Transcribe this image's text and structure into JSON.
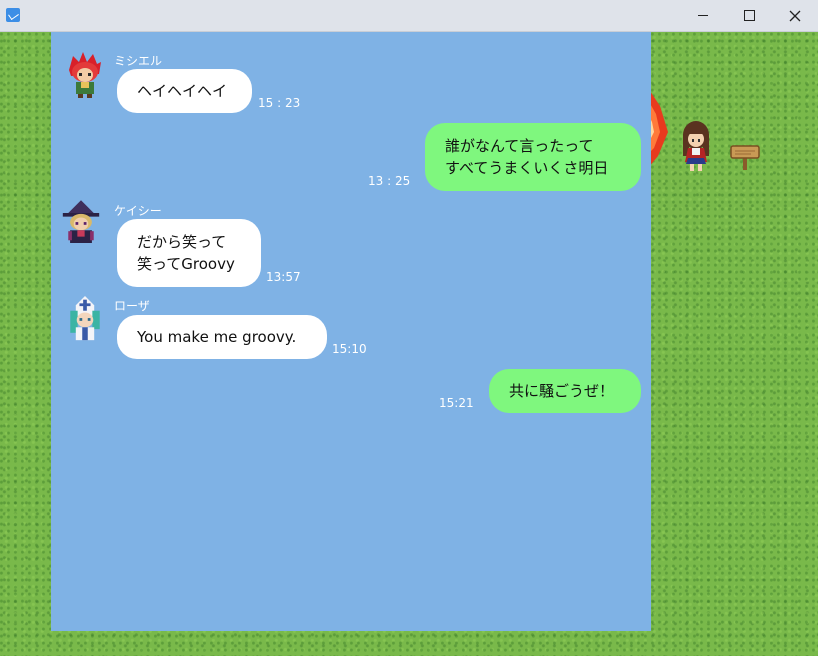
{
  "window": {
    "icon": "app-icon",
    "controls": [
      "minimize",
      "maximize",
      "close"
    ]
  },
  "messages": [
    {
      "sender": "ミシエル",
      "lines": [
        "ヘイヘイヘイ"
      ],
      "time": "15 : 23",
      "side": "left"
    },
    {
      "sender": "",
      "lines": [
        "誰がなんて言ったって",
        "すべてうまくいくさ明日"
      ],
      "time": "13 : 25",
      "side": "right"
    },
    {
      "sender": "ケイシー",
      "lines": [
        "だから笑って",
        "笑ってGroovy"
      ],
      "time": "13:57",
      "side": "left"
    },
    {
      "sender": "ローザ",
      "lines": [
        "You make me groovy."
      ],
      "time": "15:10",
      "side": "left"
    },
    {
      "sender": "",
      "lines": [
        "共に騒ごうぜ！"
      ],
      "time": "15:21",
      "side": "right"
    }
  ],
  "colors": {
    "chat_bg": "#7fb2e5",
    "bubble_other": "#ffffff",
    "bubble_self": "#7ff77e",
    "grass": "#79b94a"
  }
}
